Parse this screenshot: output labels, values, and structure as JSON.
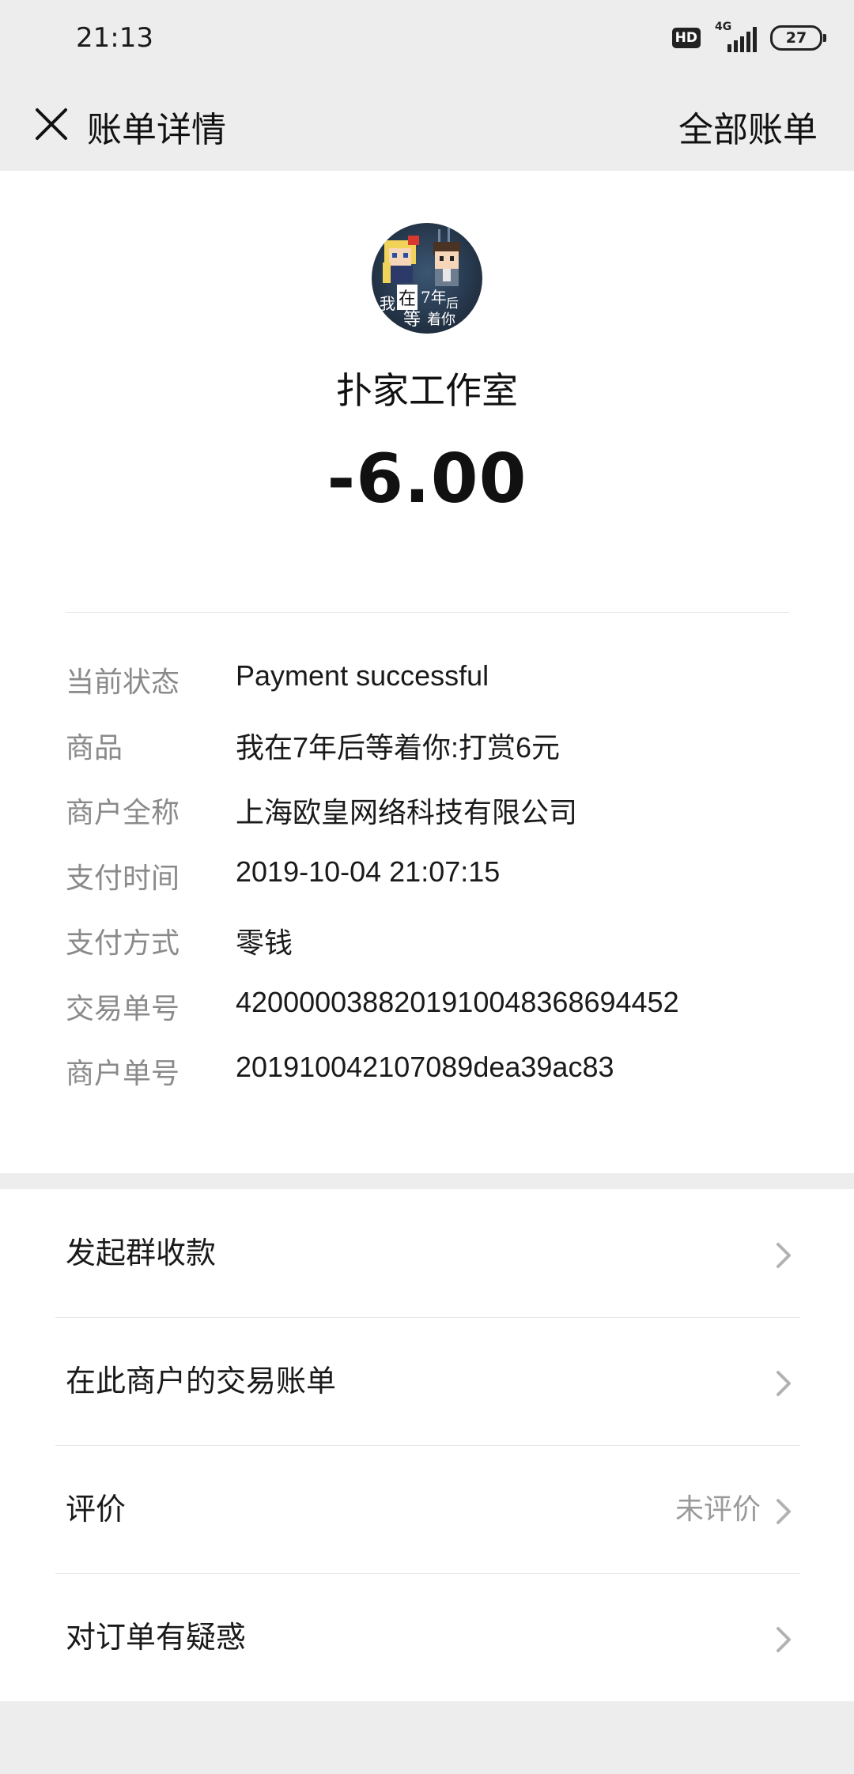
{
  "status_bar": {
    "time": "21:13",
    "hd_label": "HD",
    "network_label": "4G",
    "battery_level": "27"
  },
  "nav": {
    "title": "账单详情",
    "right_link": "全部账单",
    "close_icon": "close-icon"
  },
  "merchant": {
    "avatar_icon": "avatar-pixel-art",
    "avatar_text": [
      "我",
      "在",
      "7年",
      "后",
      "等",
      "着你"
    ],
    "name": "扑家工作室",
    "amount": "-6.00"
  },
  "details": [
    {
      "label": "当前状态",
      "value": "Payment successful"
    },
    {
      "label": "商品",
      "value": "我在7年后等着你:打赏6元"
    },
    {
      "label": "商户全称",
      "value": "上海欧皇网络科技有限公司"
    },
    {
      "label": "支付时间",
      "value": "2019-10-04 21:07:15"
    },
    {
      "label": "支付方式",
      "value": "零钱"
    },
    {
      "label": "交易单号",
      "value": "4200000388201910048368694452"
    },
    {
      "label": "商户单号",
      "value": "201910042107089dea39ac83"
    }
  ],
  "menu": [
    {
      "label": "发起群收款",
      "sub": ""
    },
    {
      "label": "在此商户的交易账单",
      "sub": ""
    },
    {
      "label": "评价",
      "sub": "未评价"
    },
    {
      "label": "对订单有疑惑",
      "sub": ""
    }
  ],
  "colors": {
    "background": "#ededed",
    "card": "#ffffff",
    "label_gray": "#8a8a8a",
    "text_dark": "#1a1a1a"
  }
}
